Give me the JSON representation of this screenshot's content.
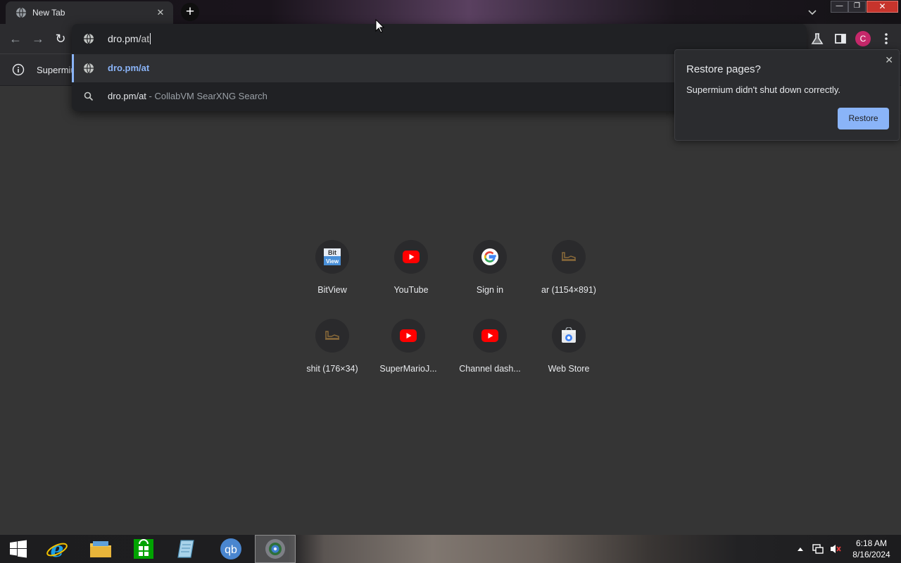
{
  "browser": {
    "tab": {
      "title": "New Tab",
      "close_glyph": "✕",
      "favicon": "globe-icon"
    },
    "new_tab_glyph": "+",
    "window_controls": {
      "minimize": "—",
      "maximize": "❐",
      "close": "✕"
    },
    "profile_initial": "C"
  },
  "nav": {
    "back": "←",
    "forward": "→",
    "reload": "↻"
  },
  "omnibox": {
    "typed": "dro.pm/",
    "autocomplete": "at",
    "suggestions": [
      {
        "text": "dro.pm/at",
        "desc": "",
        "icon": "globe-icon"
      },
      {
        "text": "dro.pm/at",
        "desc": " - CollabVM SearXNG Search",
        "icon": "search-icon"
      }
    ]
  },
  "infobar": {
    "text": "Supermiu"
  },
  "restore_bubble": {
    "title": "Restore pages?",
    "message": "Supermium didn't shut down correctly.",
    "button": "Restore",
    "close_glyph": "✕"
  },
  "shortcuts": [
    {
      "label": "BitView",
      "icon": "bitview-icon"
    },
    {
      "label": "YouTube",
      "icon": "youtube-icon"
    },
    {
      "label": "Sign in",
      "icon": "google-icon"
    },
    {
      "label": "ar (1154×891)",
      "icon": "image-icon"
    },
    {
      "label": "shit (176×34)",
      "icon": "image-icon"
    },
    {
      "label": "SuperMarioJ...",
      "icon": "youtube-icon"
    },
    {
      "label": "Channel dash...",
      "icon": "youtube-icon"
    },
    {
      "label": "Web Store",
      "icon": "webstore-icon"
    }
  ],
  "taskbar": {
    "items": [
      "start-icon",
      "internet-explorer-icon",
      "file-explorer-icon",
      "store-icon",
      "notes-icon",
      "qbittorrent-icon",
      "supermium-icon"
    ],
    "clock": {
      "time": "6:18 AM",
      "date": "8/16/2024"
    }
  },
  "colors": {
    "accent": "#8ab4f8",
    "page_bg": "#353535",
    "omnibox_bg": "#202124",
    "profile": "#c5286a"
  }
}
